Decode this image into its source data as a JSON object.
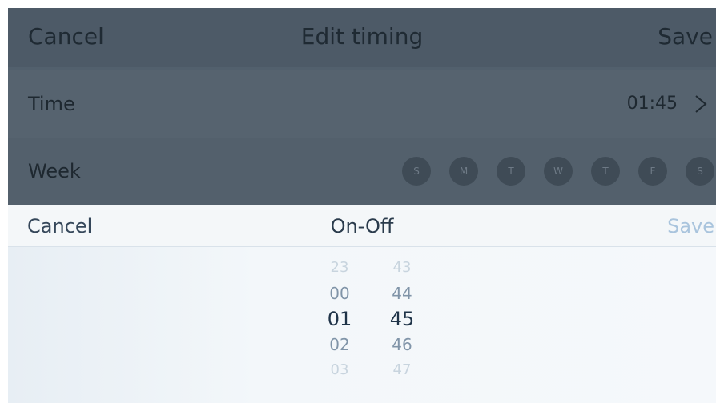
{
  "background": {
    "header": {
      "cancel": "Cancel",
      "title": "Edit timing",
      "save": "Save"
    },
    "time_row": {
      "label": "Time",
      "value": "01:45"
    },
    "week_row": {
      "label": "Week",
      "days": [
        "S",
        "M",
        "T",
        "W",
        "T",
        "F",
        "S"
      ]
    }
  },
  "sheet": {
    "cancel": "Cancel",
    "title": "On-Off",
    "save": "Save",
    "hours": [
      "23",
      "00",
      "01",
      "02",
      "03"
    ],
    "minutes": [
      "43",
      "44",
      "45",
      "46",
      "47"
    ],
    "selected_hour": "01",
    "selected_minute": "45"
  },
  "colors": {
    "overlay": "#52606d",
    "sheet_background": "#f2f6f9",
    "save_disabled": "#a9c4dd",
    "picker_selected": "#1f3348"
  }
}
